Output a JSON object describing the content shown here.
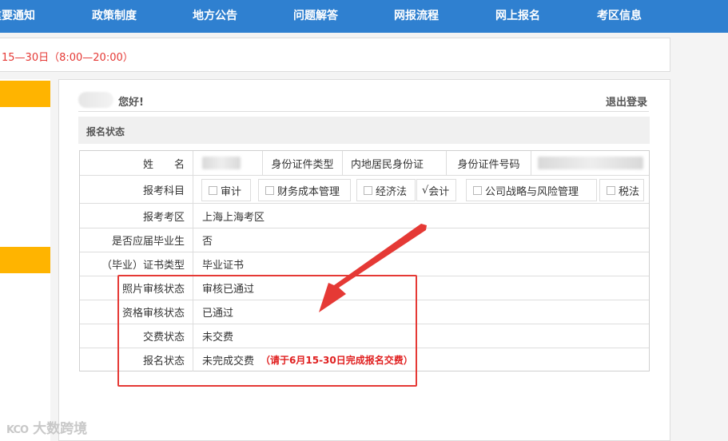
{
  "nav": {
    "items": [
      "重要通知",
      "政策制度",
      "地方公告",
      "问题解答",
      "网报流程",
      "网上报名",
      "考区信息"
    ]
  },
  "notice": {
    "text": "15—30日（8:00—20:00）"
  },
  "panel": {
    "greeting": "您好!",
    "logout": "退出登录",
    "section_title": "报名状态"
  },
  "table": {
    "name_label": "姓　　名",
    "id_type_label": "身份证件类型",
    "id_type_value": "内地居民身份证",
    "id_no_label": "身份证件号码",
    "subjects_label": "报考科目",
    "subjects": [
      {
        "label": "审计",
        "checked": false
      },
      {
        "label": "财务成本管理",
        "checked": false
      },
      {
        "label": "经济法",
        "checked": false
      },
      {
        "label": "会计",
        "checked": true,
        "mark": "√"
      },
      {
        "label": "公司战略与风险管理",
        "checked": false
      },
      {
        "label": "税法",
        "checked": false
      }
    ],
    "rows": [
      {
        "label": "报考考区",
        "value": "上海上海考区"
      },
      {
        "label": "是否应届毕业生",
        "value": "否"
      },
      {
        "label": "（毕业）证书类型",
        "value": "毕业证书"
      },
      {
        "label": "照片审核状态",
        "value": "审核已通过"
      },
      {
        "label": "资格审核状态",
        "value": "已通过"
      },
      {
        "label": "交费状态",
        "value": "未交费"
      },
      {
        "label": "报名状态",
        "value": "未完成交费",
        "note": "（请于6月15-30日完成报名交费）"
      }
    ]
  },
  "annotation": {
    "color": "#e53935"
  },
  "watermark": {
    "logo": "KCO",
    "text": "大数跨境"
  },
  "colors": {
    "nav_bg": "#2f80d0",
    "accent": "#ffb400",
    "alert": "#e53935"
  }
}
